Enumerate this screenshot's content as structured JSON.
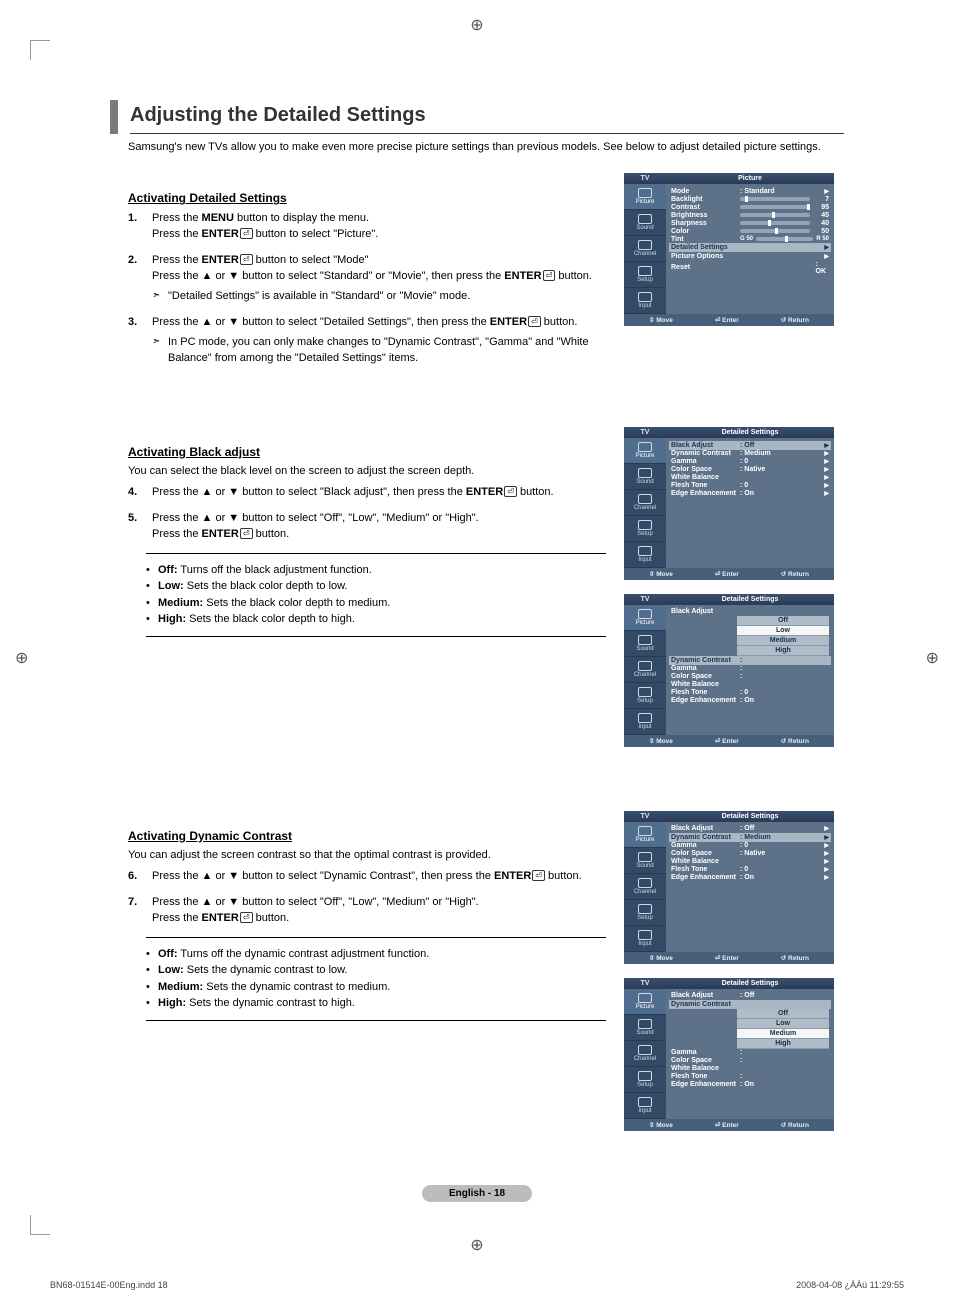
{
  "title": "Adjusting the Detailed Settings",
  "intro": "Samsung's new TVs allow you to make even more precise picture settings than previous models. See below to adjust detailed picture settings.",
  "sections": {
    "activating_detailed": {
      "heading": "Activating Detailed Settings",
      "steps": [
        {
          "line1": "Press the MENU button to display the menu.",
          "line2": "Press the ENTER⏎ button to select \"Picture\"."
        },
        {
          "line1": "Press the ENTER⏎ button to select \"Mode\"",
          "line2": "Press the ▲ or ▼ button to select \"Standard\" or \"Movie\", then press the ENTER⏎ button.",
          "note": "\"Detailed Settings\" is available in \"Standard\" or \"Movie\" mode."
        },
        {
          "line1": "Press the ▲ or ▼ button to select \"Detailed Settings\", then press the ENTER⏎ button.",
          "note": "In PC mode, you can only make changes to \"Dynamic Contrast\", \"Gamma\" and \"White Balance\" from among the \"Detailed Settings\" items."
        }
      ]
    },
    "black_adjust": {
      "heading": "Activating Black adjust",
      "sub": "You can select the black level on the screen to adjust the screen depth.",
      "steps": [
        {
          "line1": "Press the ▲ or ▼ button to select \"Black adjust\", then press the ENTER⏎ button."
        },
        {
          "line1": "Press the ▲ or ▼ button to select \"Off\", \"Low\", \"Medium\" or \"High\".",
          "line2": "Press the ENTER⏎ button."
        }
      ],
      "bullets": [
        {
          "k": "Off:",
          "v": " Turns off the black adjustment function."
        },
        {
          "k": "Low:",
          "v": " Sets the black color depth to low."
        },
        {
          "k": "Medium:",
          "v": " Sets the black color depth to medium."
        },
        {
          "k": "High:",
          "v": " Sets the black color depth to high."
        }
      ]
    },
    "dynamic_contrast": {
      "heading": "Activating Dynamic Contrast",
      "sub": "You can adjust the screen contrast so that the optimal contrast is provided.",
      "steps": [
        {
          "line1": "Press the ▲ or ▼ button to select \"Dynamic Contrast\", then press the ENTER⏎ button."
        },
        {
          "line1": "Press the ▲ or ▼ button to select \"Off\", \"Low\", \"Medium\" or \"High\".",
          "line2": "Press the ENTER⏎ button."
        }
      ],
      "bullets": [
        {
          "k": "Off:",
          "v": " Turns off the dynamic contrast adjustment function."
        },
        {
          "k": "Low:",
          "v": " Sets the dynamic contrast to low."
        },
        {
          "k": "Medium:",
          "v": " Sets the dynamic contrast to medium."
        },
        {
          "k": "High:",
          "v": " Sets the dynamic contrast to high."
        }
      ]
    }
  },
  "osd": {
    "tabs": [
      "Picture",
      "Sound",
      "Channel",
      "Setup",
      "Input"
    ],
    "foot": {
      "move": "⇳ Move",
      "enter": "⏎ Enter",
      "return": "↺ Return"
    },
    "picture_menu": {
      "head_left": "TV",
      "head_right": "Picture",
      "rows": [
        {
          "lbl": "Mode",
          "val": ": Standard",
          "arrow": "▶"
        },
        {
          "lbl": "Backlight",
          "slider": 7,
          "num": "7"
        },
        {
          "lbl": "Contrast",
          "slider": 95,
          "num": "95"
        },
        {
          "lbl": "Brightness",
          "slider": 45,
          "num": "45"
        },
        {
          "lbl": "Sharpness",
          "slider": 40,
          "num": "40"
        },
        {
          "lbl": "Color",
          "slider": 50,
          "num": "50"
        },
        {
          "lbl": "Tint",
          "tint": true,
          "g": "G  50",
          "r": "R  50"
        }
      ],
      "extra": [
        {
          "lbl": "Detailed Settings",
          "hl": true,
          "arrow": "▶"
        },
        {
          "lbl": "Picture Options",
          "arrow": "▶"
        },
        {
          "lbl": "Reset",
          "val": ": OK"
        }
      ]
    },
    "detailed_a": {
      "head_left": "TV",
      "head_right": "Detailed Settings",
      "rows": [
        {
          "lbl": "Black Adjust",
          "val": ": Off",
          "hl": true,
          "arrow": "▶"
        },
        {
          "lbl": "Dynamic Contrast",
          "val": ": Medium",
          "arrow": "▶"
        },
        {
          "lbl": "Gamma",
          "val": ":      0",
          "arrow": "▶"
        },
        {
          "lbl": "Color Space",
          "val": ": Native",
          "arrow": "▶"
        },
        {
          "lbl": "White Balance",
          "val": "",
          "arrow": "▶"
        },
        {
          "lbl": "Flesh Tone",
          "val": ":      0",
          "arrow": "▶"
        },
        {
          "lbl": "Edge Enhancement",
          "val": ": On",
          "arrow": "▶"
        }
      ]
    },
    "detailed_b": {
      "head_left": "TV",
      "head_right": "Detailed Settings",
      "rows": [
        {
          "lbl": "Black Adjust",
          "val": ":"
        },
        {
          "lbl": "Dynamic Contrast",
          "val": ":",
          "hl": true
        },
        {
          "lbl": "Gamma",
          "val": ":"
        },
        {
          "lbl": "Color Space",
          "val": ":"
        },
        {
          "lbl": "White Balance",
          "val": ""
        },
        {
          "lbl": "Flesh Tone",
          "val": ":      0"
        },
        {
          "lbl": "Edge Enhancement",
          "val": ": On"
        }
      ],
      "dropdown": [
        "Off",
        "Low",
        "Medium",
        "High"
      ],
      "sel": "Low"
    },
    "detailed_c": {
      "head_left": "TV",
      "head_right": "Detailed Settings",
      "rows": [
        {
          "lbl": "Black Adjust",
          "val": ": Off",
          "arrow": "▶"
        },
        {
          "lbl": "Dynamic Contrast",
          "val": ": Medium",
          "hl": true,
          "arrow": "▶"
        },
        {
          "lbl": "Gamma",
          "val": ":      0",
          "arrow": "▶"
        },
        {
          "lbl": "Color Space",
          "val": ": Native",
          "arrow": "▶"
        },
        {
          "lbl": "White Balance",
          "val": "",
          "arrow": "▶"
        },
        {
          "lbl": "Flesh Tone",
          "val": ":      0",
          "arrow": "▶"
        },
        {
          "lbl": "Edge Enhancement",
          "val": ": On",
          "arrow": "▶"
        }
      ]
    },
    "detailed_d": {
      "head_left": "TV",
      "head_right": "Detailed Settings",
      "rows": [
        {
          "lbl": "Black Adjust",
          "val": ": Off"
        },
        {
          "lbl": "Dynamic Contrast",
          "val": ":",
          "hl": true
        },
        {
          "lbl": "Gamma",
          "val": ":"
        },
        {
          "lbl": "Color Space",
          "val": ":"
        },
        {
          "lbl": "White Balance",
          "val": ""
        },
        {
          "lbl": "Flesh Tone",
          "val": ":"
        },
        {
          "lbl": "Edge Enhancement",
          "val": ": On"
        }
      ],
      "dropdown": [
        "Off",
        "Low",
        "Medium",
        "High"
      ],
      "sel": "Medium"
    }
  },
  "page_number": "English - 18",
  "footer": {
    "left": "BN68-01514E-00Eng.indd   18",
    "right": "2008-04-08   ¿ÀÀü 11:29:55"
  }
}
